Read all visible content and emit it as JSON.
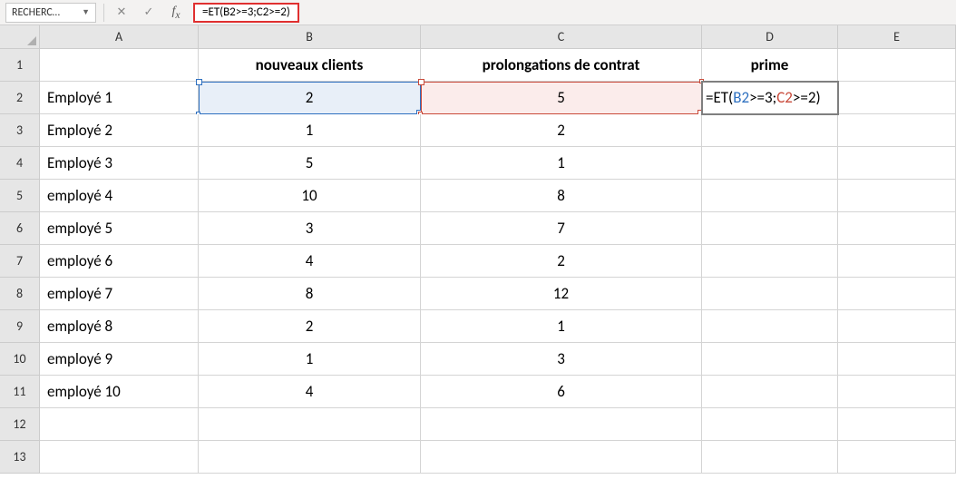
{
  "formula_bar": {
    "name_box": "RECHERC…",
    "formula": "=ET(B2>=3;C2>=2)"
  },
  "columns": [
    "A",
    "B",
    "C",
    "D",
    "E"
  ],
  "headers": {
    "A": "",
    "B": "nouveaux clients",
    "C": "prolongations de contrat",
    "D": "prime"
  },
  "rows": [
    {
      "n": "1"
    },
    {
      "n": "2",
      "A": "Employé 1",
      "B": "2",
      "C": "5"
    },
    {
      "n": "3",
      "A": "Employé 2",
      "B": "1",
      "C": "2"
    },
    {
      "n": "4",
      "A": "Employé 3",
      "B": "5",
      "C": "1"
    },
    {
      "n": "5",
      "A": "employé 4",
      "B": "10",
      "C": "8"
    },
    {
      "n": "6",
      "A": "employé 5",
      "B": "3",
      "C": "7"
    },
    {
      "n": "7",
      "A": "employé 6",
      "B": "4",
      "C": "2"
    },
    {
      "n": "8",
      "A": "employé 7",
      "B": "8",
      "C": "12"
    },
    {
      "n": "9",
      "A": "employé 8",
      "B": "2",
      "C": "1"
    },
    {
      "n": "10",
      "A": "employé 9",
      "B": "1",
      "C": "3"
    },
    {
      "n": "11",
      "A": "employé 10",
      "B": "4",
      "C": "6"
    },
    {
      "n": "12"
    },
    {
      "n": "13"
    }
  ],
  "editing_cell": {
    "prefix": "=ET(",
    "ref1": "B2",
    "mid1": ">=3;",
    "ref2": "C2",
    "mid2": ">=2)"
  },
  "colors": {
    "ref1": "#2e70c0",
    "ref2": "#c94a3a",
    "highlight_box": "#e03030"
  }
}
